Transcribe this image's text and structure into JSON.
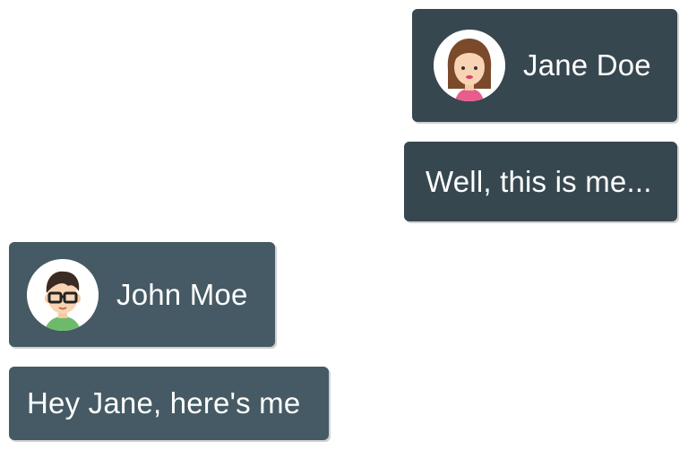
{
  "conversation": {
    "messages": [
      {
        "sender": "Jane Doe",
        "side": "right",
        "avatar_icon": "female-avatar-icon",
        "text": "Well, this is me..."
      },
      {
        "sender": "John Moe",
        "side": "left",
        "avatar_icon": "male-avatar-glasses-icon",
        "text": "Hey Jane, here's me"
      }
    ]
  },
  "colors": {
    "outgoing_bubble": "#37474f",
    "incoming_bubble": "#455a64",
    "text": "#ffffff",
    "background": "#ffffff"
  }
}
